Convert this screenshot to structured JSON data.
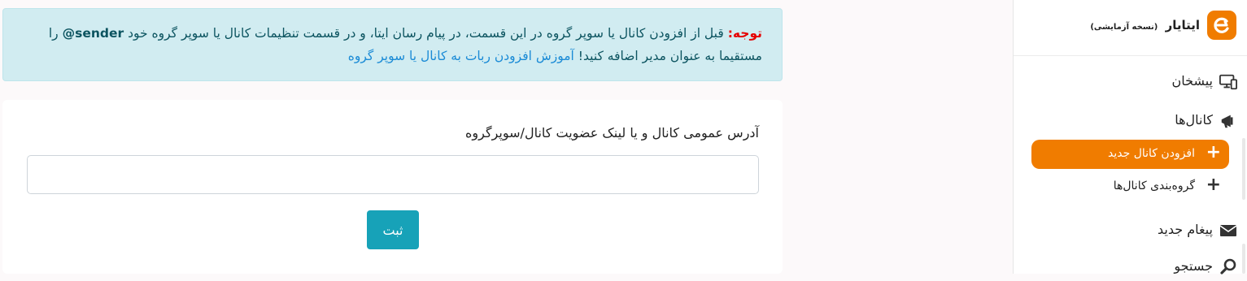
{
  "sidebar": {
    "brand": {
      "name": "ایتایار",
      "subtitle": "(نسخه آزمایشی)",
      "logo_color": "#f07c00"
    },
    "items": [
      {
        "label": "پیشخان",
        "icon": "dashboard-monitor-icon"
      },
      {
        "label": "کانال‌ها",
        "icon": "megaphone-icon"
      },
      {
        "label": "افزودن کانال جدید",
        "icon": "plus-icon",
        "active": true
      },
      {
        "label": "گروه‌بندی کانال‌ها",
        "icon": "plus-icon"
      },
      {
        "label": "پیغام جدید",
        "icon": "envelope-icon"
      },
      {
        "label": "جستجو",
        "icon": "search-icon"
      }
    ]
  },
  "alert": {
    "prefix": "توجه:",
    "text1": "قبل از افزودن کانال یا سوپر گروه در این قسمت، در پیام رسان ایتا، و در قسمت تنظیمات کانال یا سوپر گروه خود",
    "bot": "@sender",
    "text2": "را مستقیما به عنوان مدیر اضافه کنید!",
    "link": "آموزش افزودن ربات به کانال یا سوپر گروه"
  },
  "form": {
    "label": "آدرس عمومی کانال و یا لینک عضویت کانال/سوپرگروه",
    "input_value": "",
    "submit_label": "ثبت"
  },
  "colors": {
    "accent": "#f07c00",
    "submit": "#17a2b8",
    "alert_bg": "#d1ecf1",
    "link": "#1b8bd6",
    "warning": "#e60000"
  }
}
